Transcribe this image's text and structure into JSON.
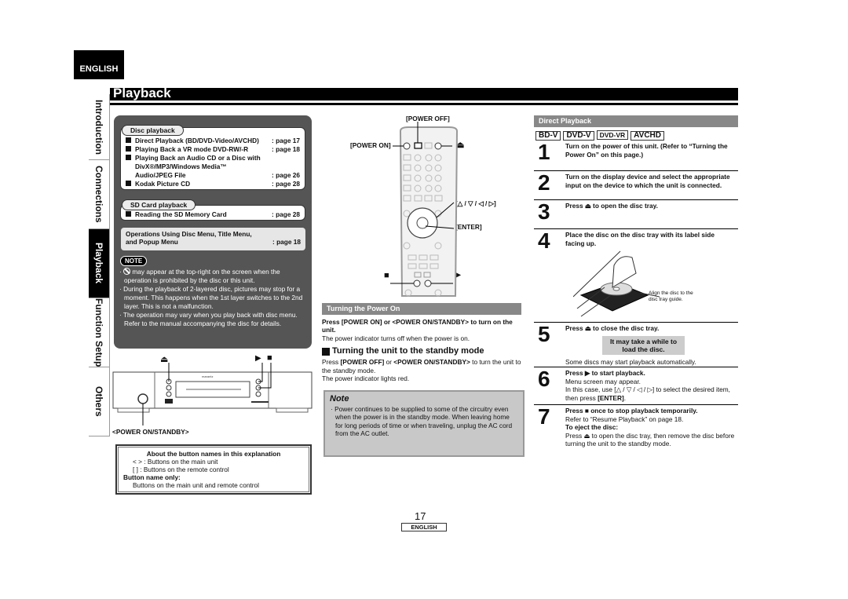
{
  "header": {
    "language_tab": "ENGLISH",
    "page_title": "Playback"
  },
  "side_tabs": [
    {
      "label": "Introduction",
      "active": false
    },
    {
      "label": "Connections",
      "active": false
    },
    {
      "label": "Playback",
      "active": true
    },
    {
      "label": "Function Setup",
      "active": false
    },
    {
      "label": "Others",
      "active": false
    }
  ],
  "toc": {
    "disc_playback": {
      "label": "Disc playback",
      "items": [
        {
          "text": "Direct Playback (BD/DVD-Video/AVCHD)",
          "page": ": page 17"
        },
        {
          "text": "Playing Back a VR mode DVD-RW/-R",
          "page": ": page 18"
        },
        {
          "text": "Playing Back an Audio CD or a Disc with DivX®/MP3/Windows Media™ Audio/JPEG File",
          "page": ": page 26"
        },
        {
          "text": "Kodak Picture CD",
          "page": ": page 28"
        }
      ]
    },
    "sd_card": {
      "label": "SD Card playback",
      "items": [
        {
          "text": "Reading the SD Memory Card",
          "page": ": page 28"
        }
      ]
    },
    "operations": {
      "line1": "Operations Using Disc Menu, Title Menu,",
      "line2": "and Popup Menu",
      "page": ": page 18"
    },
    "note": {
      "badge": "NOTE",
      "items": [
        "may appear at the top-right on the screen when the operation is prohibited by the disc or this unit.",
        "During the playback of 2-layered disc, pictures may stop for a moment. This happens when the 1st layer switches to the 2nd layer. This is not a malfunction.",
        "The operation may vary when you play back with disc menu. Refer to the manual accompanying the disc for details."
      ]
    }
  },
  "player_diagram": {
    "eject_symbol": "⏏",
    "play_symbol": "▶",
    "stop_symbol": "■",
    "power_label": "<POWER ON/STANDBY>"
  },
  "about_box": {
    "title": "About the button names in this explanation",
    "line1": "< > : Buttons on the main unit",
    "line2": "[  ] : Buttons on the remote control",
    "subtitle": "Button name only:",
    "line3": "Buttons on the main unit and remote control"
  },
  "remote_diagram": {
    "power_off": "[POWER OFF]",
    "power_on": "[POWER ON]",
    "eject": "⏏",
    "arrows": "[△ / ▽ / ◁ / ▷]",
    "enter": "[ENTER]",
    "stop": "■",
    "play": "▶"
  },
  "power_section": {
    "header": "Turning the Power On",
    "instruction": "Press [POWER ON] or <POWER ON/STANDBY> to turn on the unit.",
    "info": "The power indicator turns off when the power is on.",
    "standby_title": "Turning the unit to the standby mode",
    "standby_press": "Press ",
    "standby_b1": "[POWER OFF]",
    "standby_or": " or ",
    "standby_b2": "<POWER ON/STANDBY>",
    "standby_rest": " to turn the unit to the standby mode.",
    "standby_info": "The power indicator lights red.",
    "note_title": "Note",
    "note_text": "Power continues to be supplied to some of the circuitry even when the power is in the standby mode. When leaving home for long periods of time or when traveling, unplug the AC cord from the AC outlet."
  },
  "direct_playback": {
    "header": "Direct Playback",
    "badges": [
      "BD-V",
      "DVD-V",
      "DVD-VR",
      "AVCHD"
    ],
    "steps": [
      {
        "num": "1",
        "text": "Turn on the power of this unit. (Refer to “Turning the Power On” on this page.)"
      },
      {
        "num": "2",
        "text": "Turn on the display device and select the appropriate input on the device to which the unit is connected."
      },
      {
        "num": "3",
        "text": "Press ⏏ to open the disc tray."
      },
      {
        "num": "4",
        "text": "Place the disc on the disc tray with its label side facing up."
      },
      {
        "num": "5",
        "text": "Press ⏏ to close the disc tray.",
        "callout": "It may take a while to load the disc.",
        "extra": "Some discs may start playback automatically."
      },
      {
        "num": "6",
        "text": "Press ▶ to start playback.",
        "extra1": "Menu screen may appear.",
        "extra2": "In this case, use [△ / ▽ / ◁ / ▷] to select the desired item, then press ",
        "extra2_b": "[ENTER]",
        "extra2_end": "."
      },
      {
        "num": "7",
        "text": "Press ■ once to stop playback temporarily.",
        "extra1": "Refer to “Resume Playback” on page 18.",
        "sub_title": "To eject the disc:",
        "sub_text": "Press ⏏ to open the disc tray, then remove the disc before turning the unit to the standby mode."
      }
    ],
    "disc_caption": "Align the disc to the disc tray guide."
  },
  "footer": {
    "page_number": "17",
    "language": "ENGLISH"
  }
}
